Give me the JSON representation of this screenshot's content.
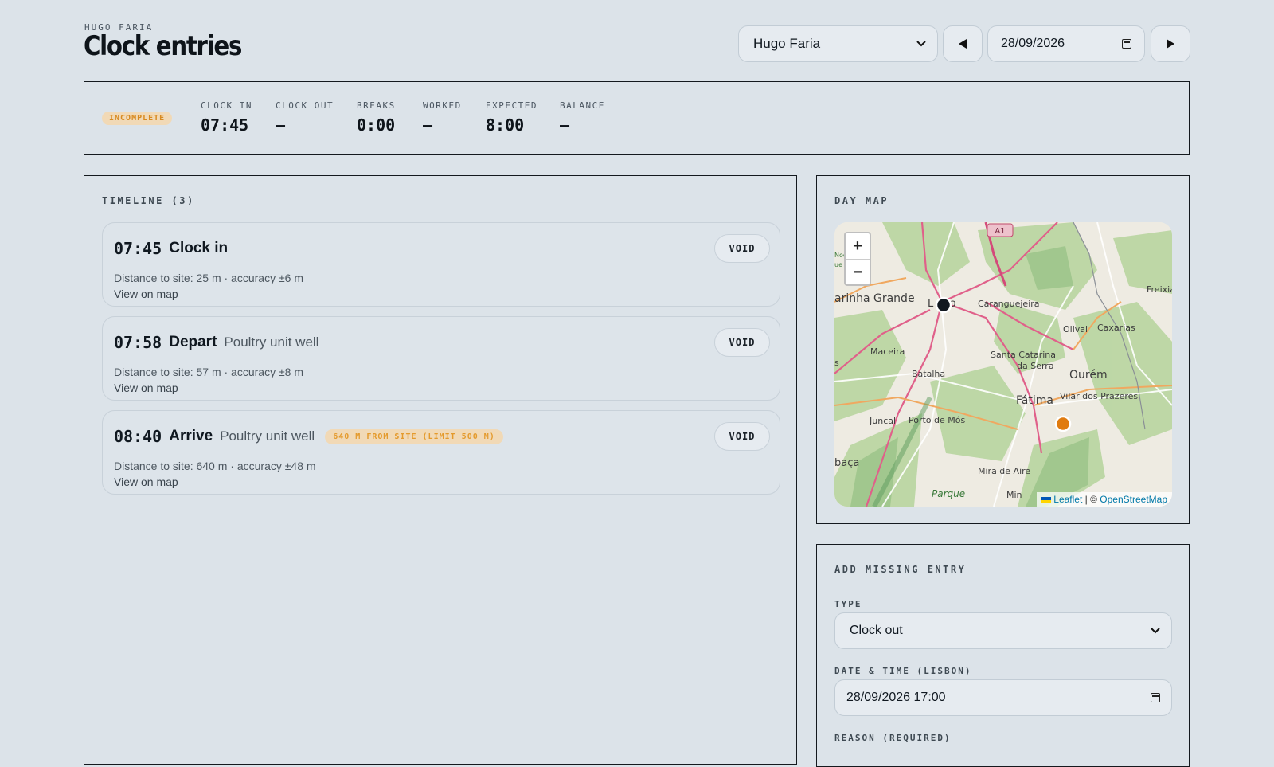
{
  "header": {
    "eyebrow": "HUGO FARIA",
    "title": "Clock entries",
    "employee_select": "Hugo Faria",
    "date": "28/09/2026"
  },
  "summary": {
    "status": "INCOMPLETE",
    "stats": [
      {
        "label": "CLOCK IN",
        "value": "07:45"
      },
      {
        "label": "CLOCK OUT",
        "value": "—"
      },
      {
        "label": "BREAKS",
        "value": "0:00"
      },
      {
        "label": "WORKED",
        "value": "—"
      },
      {
        "label": "EXPECTED",
        "value": "8:00"
      },
      {
        "label": "BALANCE",
        "value": "—"
      }
    ]
  },
  "timeline": {
    "heading": "TIMELINE (3)",
    "void_label": "VOID",
    "link_label": "View on map",
    "entries": [
      {
        "time": "07:45",
        "type": "Clock in",
        "place": "",
        "warning": "",
        "meta": "Distance to site: 25 m · accuracy ±6 m"
      },
      {
        "time": "07:58",
        "type": "Depart",
        "place": "Poultry unit well",
        "warning": "",
        "meta": "Distance to site: 57 m · accuracy ±8 m"
      },
      {
        "time": "08:40",
        "type": "Arrive",
        "place": "Poultry unit well",
        "warning": "640 M FROM SITE (LIMIT 500 M)",
        "meta": "Distance to site: 640 m · accuracy ±48 m"
      }
    ]
  },
  "map": {
    "heading": "DAY MAP",
    "places": {
      "marinha": "arinha Grande",
      "leiria_l": "L",
      "leiria_a": "a",
      "caranguejeira": "Caranguejeira",
      "freixia": "Freixia",
      "olival": "Olival",
      "caxarias": "Caxarias",
      "maceira": "Maceira",
      "santa_catarina": "Santa Catarina",
      "da_serra": "da Serra",
      "s": "s",
      "batalha": "Batalha",
      "ourem": "Ourém",
      "fatima": "Fátima",
      "vilar": "Vilar dos Prazeres",
      "juncal": "Juncal",
      "porto_de_mos": "Porto de Mós",
      "alcobaca": "baça",
      "mira_de_aire": "Mira de Aire",
      "parque": "Parque",
      "min": "Min",
      "nos": "Noc",
      "ae": "ue"
    },
    "road_label": "A1",
    "zoom_in": "+",
    "zoom_out": "−",
    "attribution_leaflet": "Leaflet",
    "attribution_sep": " | © ",
    "attribution_osm": "OpenStreetMap",
    "colors": {
      "marker_primary": "#111820",
      "marker_warning": "#e07b10"
    }
  },
  "add_entry": {
    "heading": "ADD MISSING ENTRY",
    "type_label": "TYPE",
    "type_value": "Clock out",
    "datetime_label": "DATE & TIME (LISBON)",
    "datetime_value": "28/09/2026 17:00",
    "reason_label": "REASON (REQUIRED)"
  }
}
